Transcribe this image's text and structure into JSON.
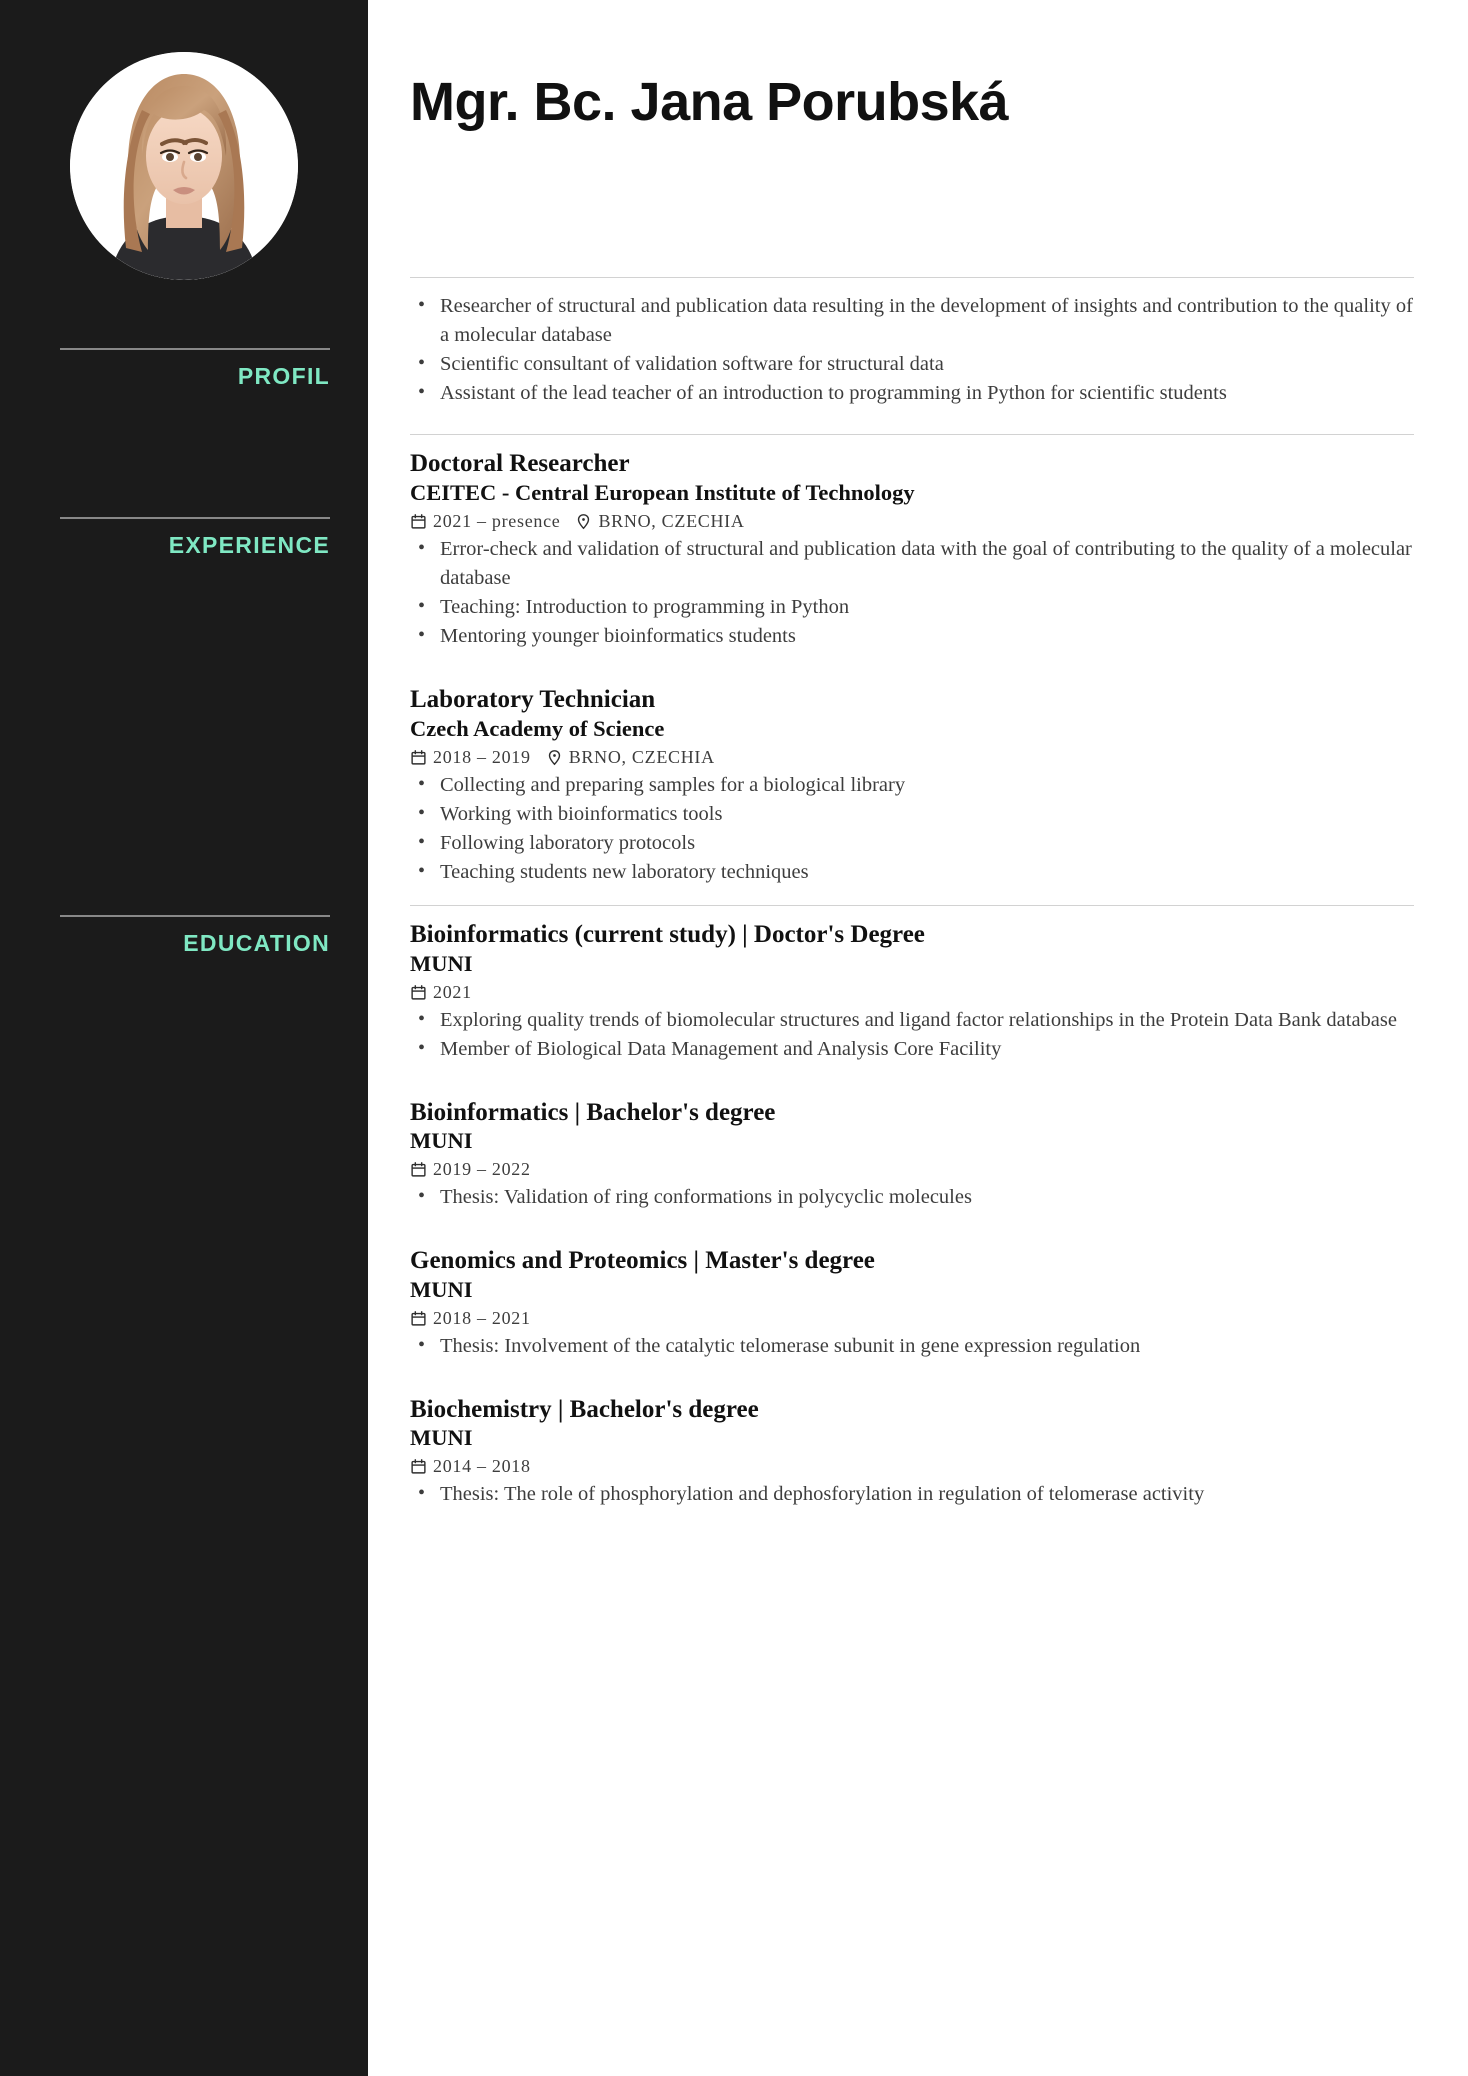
{
  "accent_color": "#7fe8c3",
  "sidebar_bg": "#1b1b1b",
  "header": {
    "name": "Mgr. Bc. Jana Porubská"
  },
  "avatar": {
    "alt": "portrait-photo"
  },
  "sidebar": {
    "sections": [
      {
        "id": "profil",
        "label": "PROFIL"
      },
      {
        "id": "experience",
        "label": "EXPERIENCE"
      },
      {
        "id": "education",
        "label": "EDUCATION"
      }
    ]
  },
  "profile": {
    "bullets": [
      "Researcher of structural and publication data resulting in the development of insights and contribution to the quality of a molecular database",
      "Scientific consultant of validation software for structural data",
      "Assistant of the lead teacher of an introduction to programming in Python for scientific students"
    ]
  },
  "experience": {
    "entries": [
      {
        "title": "Doctoral Researcher",
        "org": "CEITEC - Central European Institute of Technology",
        "date": "2021 – presence",
        "location": "BRNO, CZECHIA",
        "bullets": [
          "Error-check and validation of structural and publication data with the goal of contributing to the quality of a molecular database",
          "Teaching: Introduction to programming in Python",
          "Mentoring younger bioinformatics students"
        ]
      },
      {
        "title": "Laboratory Technician",
        "org": "Czech Academy of Science",
        "date": "2018 – 2019",
        "location": "BRNO, CZECHIA",
        "bullets": [
          "Collecting and preparing samples for a biological library",
          "Working with bioinformatics tools",
          "Following laboratory protocols",
          "Teaching students new laboratory techniques"
        ]
      }
    ]
  },
  "education": {
    "entries": [
      {
        "title": "Bioinformatics (current study) | Doctor's Degree",
        "org": "MUNI",
        "date": "2021",
        "location": "",
        "bullets": [
          "Exploring quality trends of biomolecular structures and ligand factor relationships in the Protein Data Bank database",
          "Member of Biological Data Management and Analysis Core Facility"
        ]
      },
      {
        "title": "Bioinformatics | Bachelor's degree",
        "org": "MUNI",
        "date": "2019 – 2022",
        "location": "",
        "bullets": [
          "Thesis: Validation of ring conformations in polycyclic molecules"
        ]
      },
      {
        "title": "Genomics and Proteomics | Master's degree",
        "org": "MUNI",
        "date": "2018 – 2021",
        "location": "",
        "bullets": [
          "Thesis: Involvement of the catalytic telomerase subunit in gene expression regulation"
        ]
      },
      {
        "title": "Biochemistry | Bachelor's degree",
        "org": "MUNI",
        "date": "2014 – 2018",
        "location": "",
        "bullets": [
          "Thesis: The role of phosphorylation and dephosforylation in regulation of telomerase activity"
        ]
      }
    ]
  },
  "icons": {
    "calendar": "calendar-icon",
    "location": "location-pin-icon"
  }
}
